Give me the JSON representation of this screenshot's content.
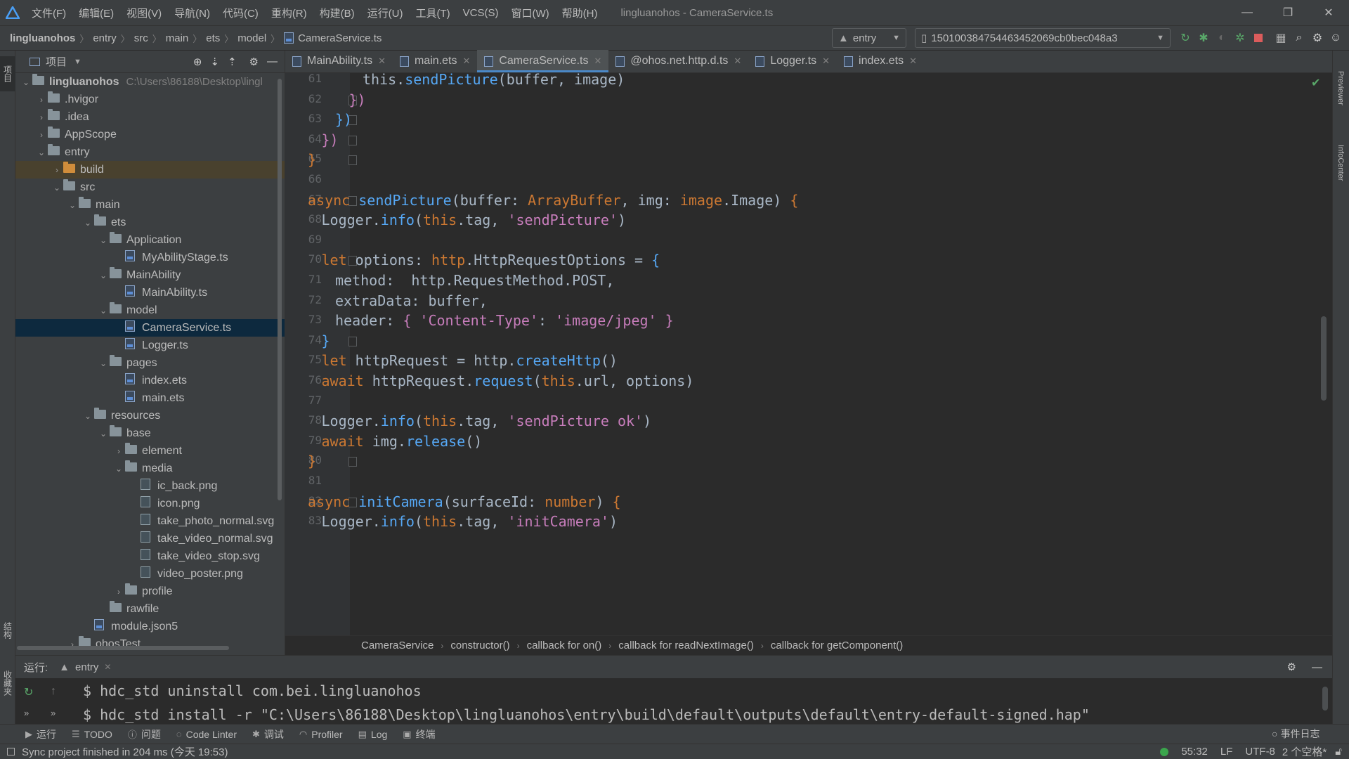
{
  "menu": {
    "items": [
      "文件(F)",
      "编辑(E)",
      "视图(V)",
      "导航(N)",
      "代码(C)",
      "重构(R)",
      "构建(B)",
      "运行(U)",
      "工具(T)",
      "VCS(S)",
      "窗口(W)",
      "帮助(H)"
    ],
    "window_title": "lingluanohos - CameraService.ts"
  },
  "breadcrumb": [
    "lingluanohos",
    "entry",
    "src",
    "main",
    "ets",
    "model",
    "CameraService.ts"
  ],
  "run_config": "entry",
  "device": "150100384754463452069cb0bec048a3",
  "project_panel": {
    "title": "项目",
    "root_name": "lingluanohos",
    "root_path": "C:\\Users\\86188\\Desktop\\lingl",
    "tree": [
      {
        "label": ".hvigor",
        "depth": 1,
        "type": "folder",
        "chev": "closed"
      },
      {
        "label": ".idea",
        "depth": 1,
        "type": "folder",
        "chev": "closed"
      },
      {
        "label": "AppScope",
        "depth": 1,
        "type": "folder",
        "chev": "closed"
      },
      {
        "label": "entry",
        "depth": 1,
        "type": "folder",
        "chev": "open"
      },
      {
        "label": "build",
        "depth": 2,
        "type": "folder-orange",
        "chev": "closed",
        "state": "build"
      },
      {
        "label": "src",
        "depth": 2,
        "type": "folder",
        "chev": "open"
      },
      {
        "label": "main",
        "depth": 3,
        "type": "folder",
        "chev": "open"
      },
      {
        "label": "ets",
        "depth": 4,
        "type": "folder",
        "chev": "open"
      },
      {
        "label": "Application",
        "depth": 5,
        "type": "folder",
        "chev": "open"
      },
      {
        "label": "MyAbilityStage.ts",
        "depth": 6,
        "type": "ts",
        "chev": "none"
      },
      {
        "label": "MainAbility",
        "depth": 5,
        "type": "folder",
        "chev": "open"
      },
      {
        "label": "MainAbility.ts",
        "depth": 6,
        "type": "ts",
        "chev": "none"
      },
      {
        "label": "model",
        "depth": 5,
        "type": "folder",
        "chev": "open"
      },
      {
        "label": "CameraService.ts",
        "depth": 6,
        "type": "ts",
        "chev": "none",
        "state": "selected"
      },
      {
        "label": "Logger.ts",
        "depth": 6,
        "type": "ts",
        "chev": "none"
      },
      {
        "label": "pages",
        "depth": 5,
        "type": "folder",
        "chev": "open"
      },
      {
        "label": "index.ets",
        "depth": 6,
        "type": "ts",
        "chev": "none"
      },
      {
        "label": "main.ets",
        "depth": 6,
        "type": "ts",
        "chev": "none"
      },
      {
        "label": "resources",
        "depth": 4,
        "type": "folder",
        "chev": "open"
      },
      {
        "label": "base",
        "depth": 5,
        "type": "folder",
        "chev": "open"
      },
      {
        "label": "element",
        "depth": 6,
        "type": "folder",
        "chev": "closed"
      },
      {
        "label": "media",
        "depth": 6,
        "type": "folder",
        "chev": "open"
      },
      {
        "label": "ic_back.png",
        "depth": 7,
        "type": "img",
        "chev": "none"
      },
      {
        "label": "icon.png",
        "depth": 7,
        "type": "img",
        "chev": "none"
      },
      {
        "label": "take_photo_normal.svg",
        "depth": 7,
        "type": "img",
        "chev": "none"
      },
      {
        "label": "take_video_normal.svg",
        "depth": 7,
        "type": "img",
        "chev": "none"
      },
      {
        "label": "take_video_stop.svg",
        "depth": 7,
        "type": "img",
        "chev": "none"
      },
      {
        "label": "video_poster.png",
        "depth": 7,
        "type": "img",
        "chev": "none"
      },
      {
        "label": "profile",
        "depth": 6,
        "type": "folder",
        "chev": "closed"
      },
      {
        "label": "rawfile",
        "depth": 5,
        "type": "folder",
        "chev": "none"
      },
      {
        "label": "module.json5",
        "depth": 4,
        "type": "ts",
        "chev": "none"
      },
      {
        "label": "ohosTest",
        "depth": 3,
        "type": "folder",
        "chev": "closed"
      }
    ]
  },
  "tabs": [
    {
      "label": "MainAbility.ts",
      "active": false
    },
    {
      "label": "main.ets",
      "active": false
    },
    {
      "label": "CameraService.ts",
      "active": true
    },
    {
      "label": "@ohos.net.http.d.ts",
      "active": false
    },
    {
      "label": "Logger.ts",
      "active": false
    },
    {
      "label": "index.ets",
      "active": false
    }
  ],
  "code_lines": [
    {
      "n": "61",
      "indent": 4,
      "html": "this.<span class=\"fn\">sendPicture</span>(buffer, image)",
      "fold": false
    },
    {
      "n": "62",
      "indent": 3,
      "html": "<span class=\"ty\">})</span>",
      "fold": true
    },
    {
      "n": "63",
      "indent": 2,
      "html": "<span class=\"fn\">})</span>",
      "fold": true
    },
    {
      "n": "64",
      "indent": 1,
      "html": "<span class=\"ty\">})</span>",
      "fold": true
    },
    {
      "n": "65",
      "indent": 0,
      "html": "<span class=\"kw\">}</span>",
      "fold": true
    },
    {
      "n": "66",
      "indent": 0,
      "html": "",
      "fold": false
    },
    {
      "n": "67",
      "indent": 0,
      "html": "<span class=\"kw\">async</span> <span class=\"fn\">sendPicture</span>(buffer: <span class=\"kw\">ArrayBuffer</span>, img: <span class=\"kw\">image</span>.Image) <span class=\"kw\">{</span>",
      "fold": true
    },
    {
      "n": "68",
      "indent": 1,
      "html": "Logger.<span class=\"fn\">info</span>(<span class=\"kw\">this</span>.tag, <span class=\"str2\">'sendPicture'</span>)",
      "fold": false
    },
    {
      "n": "69",
      "indent": 0,
      "html": "",
      "fold": false
    },
    {
      "n": "70",
      "indent": 1,
      "html": "<span class=\"kw\">let</span> options: <span class=\"kw\">http</span>.HttpRequestOptions = <span class=\"fn\">{</span>",
      "fold": true
    },
    {
      "n": "71",
      "indent": 2,
      "html": "method:  http.RequestMethod.POST,",
      "fold": false
    },
    {
      "n": "72",
      "indent": 2,
      "html": "extraData: buffer,",
      "fold": false
    },
    {
      "n": "73",
      "indent": 2,
      "html": "header: <span class=\"ty\">{</span> <span class=\"str2\">'Content-Type'</span>: <span class=\"str2\">'image/jpeg'</span> <span class=\"ty\">}</span>",
      "fold": false
    },
    {
      "n": "74",
      "indent": 1,
      "html": "<span class=\"fn\">}</span>",
      "fold": true
    },
    {
      "n": "75",
      "indent": 1,
      "html": "<span class=\"kw\">let</span> httpRequest = http.<span class=\"fn\">createHttp</span>()",
      "fold": false
    },
    {
      "n": "76",
      "indent": 1,
      "html": "<span class=\"kw\">await</span> httpRequest.<span class=\"fn\">request</span>(<span class=\"kw\">this</span>.url, options)",
      "fold": false
    },
    {
      "n": "77",
      "indent": 0,
      "html": "",
      "fold": false
    },
    {
      "n": "78",
      "indent": 1,
      "html": "Logger.<span class=\"fn\">info</span>(<span class=\"kw\">this</span>.tag, <span class=\"str2\">'sendPicture ok'</span>)",
      "fold": false
    },
    {
      "n": "79",
      "indent": 1,
      "html": "<span class=\"kw\">await</span> img.<span class=\"fn\">release</span>()",
      "fold": false
    },
    {
      "n": "80",
      "indent": 0,
      "html": "<span class=\"kw\">}</span>",
      "fold": true
    },
    {
      "n": "81",
      "indent": 0,
      "html": "",
      "fold": false
    },
    {
      "n": "82",
      "indent": 0,
      "html": "<span class=\"kw\">async</span> <span class=\"fn\">initCamera</span>(surfaceId: <span class=\"kw\">number</span>) <span class=\"kw\">{</span>",
      "fold": true
    },
    {
      "n": "83",
      "indent": 1,
      "html": "Logger.<span class=\"fn\">info</span>(<span class=\"kw\">this</span>.tag, <span class=\"str2\">'initCamera'</span>)",
      "fold": false
    }
  ],
  "editor_breadcrumb": [
    "CameraService",
    "constructor()",
    "callback for on()",
    "callback for readNextImage()",
    "callback for getComponent()"
  ],
  "run_panel": {
    "label": "运行:",
    "tab": "entry",
    "lines": [
      "$ hdc_std uninstall com.bei.lingluanohos",
      "$ hdc_std install -r \"C:\\Users\\86188\\Desktop\\lingluanohos\\entry\\build\\default\\outputs\\default\\entry-default-signed.hap\""
    ]
  },
  "tool_tabs": [
    "运行",
    "TODO",
    "问题",
    "Code Linter",
    "调试",
    "Profiler",
    "Log",
    "终端"
  ],
  "status": {
    "message": "Sync project finished in 204 ms (今天 19:53)",
    "position": "55:32",
    "line_sep": "LF",
    "encoding": "UTF-8",
    "indent": "2 个空格*",
    "event_log": "事件日志"
  },
  "side_tabs": {
    "left_top": "项目",
    "left_mid": "结构",
    "left_bottom": "收藏夹",
    "right_top": "Previewer",
    "right_mid": "InfoCenter"
  },
  "colors": {
    "keyword": "#cc7832",
    "function": "#56a8f5",
    "string": "#c77dbb",
    "accent": "#4a88c7"
  }
}
